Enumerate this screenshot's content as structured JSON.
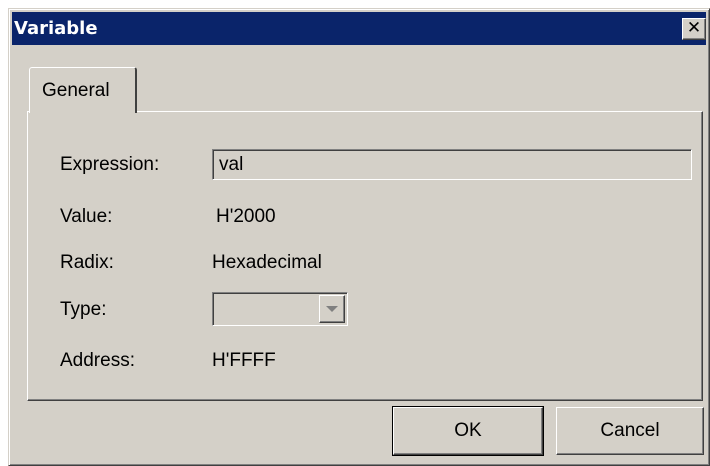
{
  "window": {
    "title": "Variable",
    "close_label": "✕"
  },
  "tabs": [
    {
      "label": "General"
    }
  ],
  "fields": {
    "expression": {
      "label": "Expression:",
      "value": "val"
    },
    "value": {
      "label": "Value:",
      "value": "H'2000"
    },
    "radix": {
      "label": "Radix:",
      "value": "Hexadecimal"
    },
    "type": {
      "label": "Type:",
      "value": ""
    },
    "address": {
      "label": "Address:",
      "value": "H'FFFF"
    }
  },
  "buttons": {
    "ok": "OK",
    "cancel": "Cancel"
  },
  "colors": {
    "titlebar": "#0a246a",
    "face": "#d4d0c8"
  }
}
